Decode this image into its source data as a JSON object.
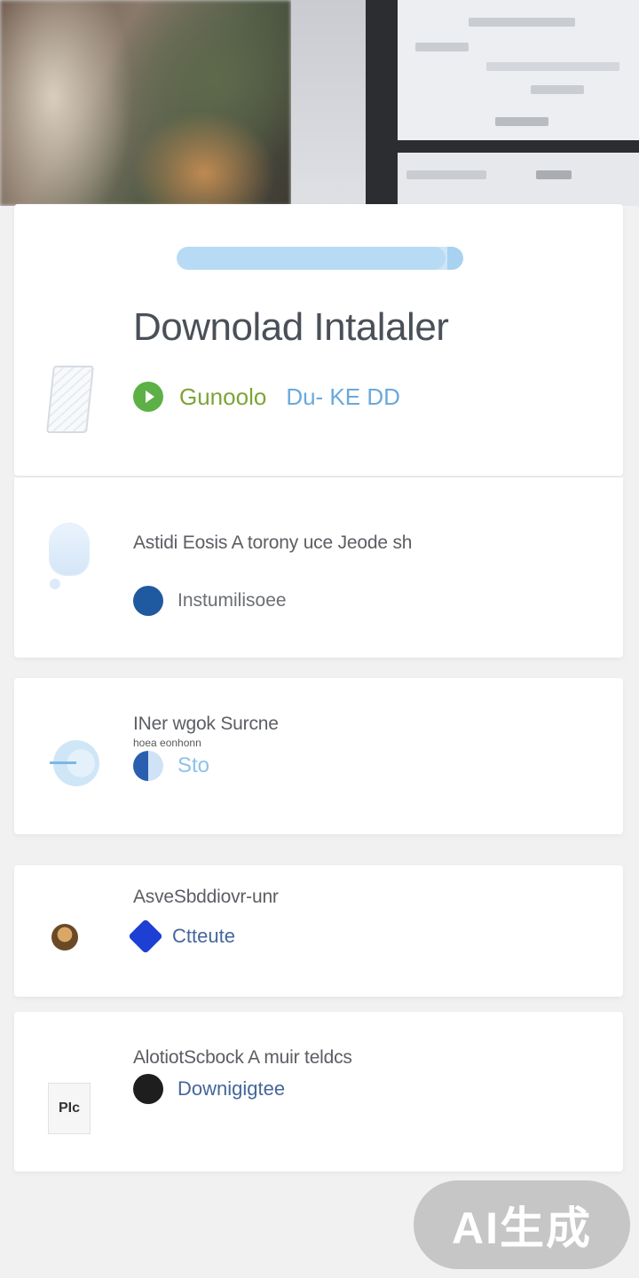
{
  "progress": {
    "fraction": 0.94
  },
  "installer": {
    "title": "Downolad Intalaler",
    "status_left": "Gunoolo",
    "status_right": "Du- KE DD"
  },
  "items": [
    {
      "title": "Astidi Eosis A torony uce Jeode sh",
      "subtitle": "",
      "action": "Instumilisoee"
    },
    {
      "title": "INer wgok Surcne",
      "subtitle": "hoea eonhonn",
      "action": "Sto"
    },
    {
      "title": "AsveSbddiovr-unr",
      "subtitle": "",
      "action": "Ctteute"
    },
    {
      "title": "AlotiotScbock A muir teldcs",
      "subtitle": "",
      "action": "Downigigtee"
    }
  ],
  "bookmark_label": "PIc",
  "badge": {
    "label": "AI生成"
  }
}
